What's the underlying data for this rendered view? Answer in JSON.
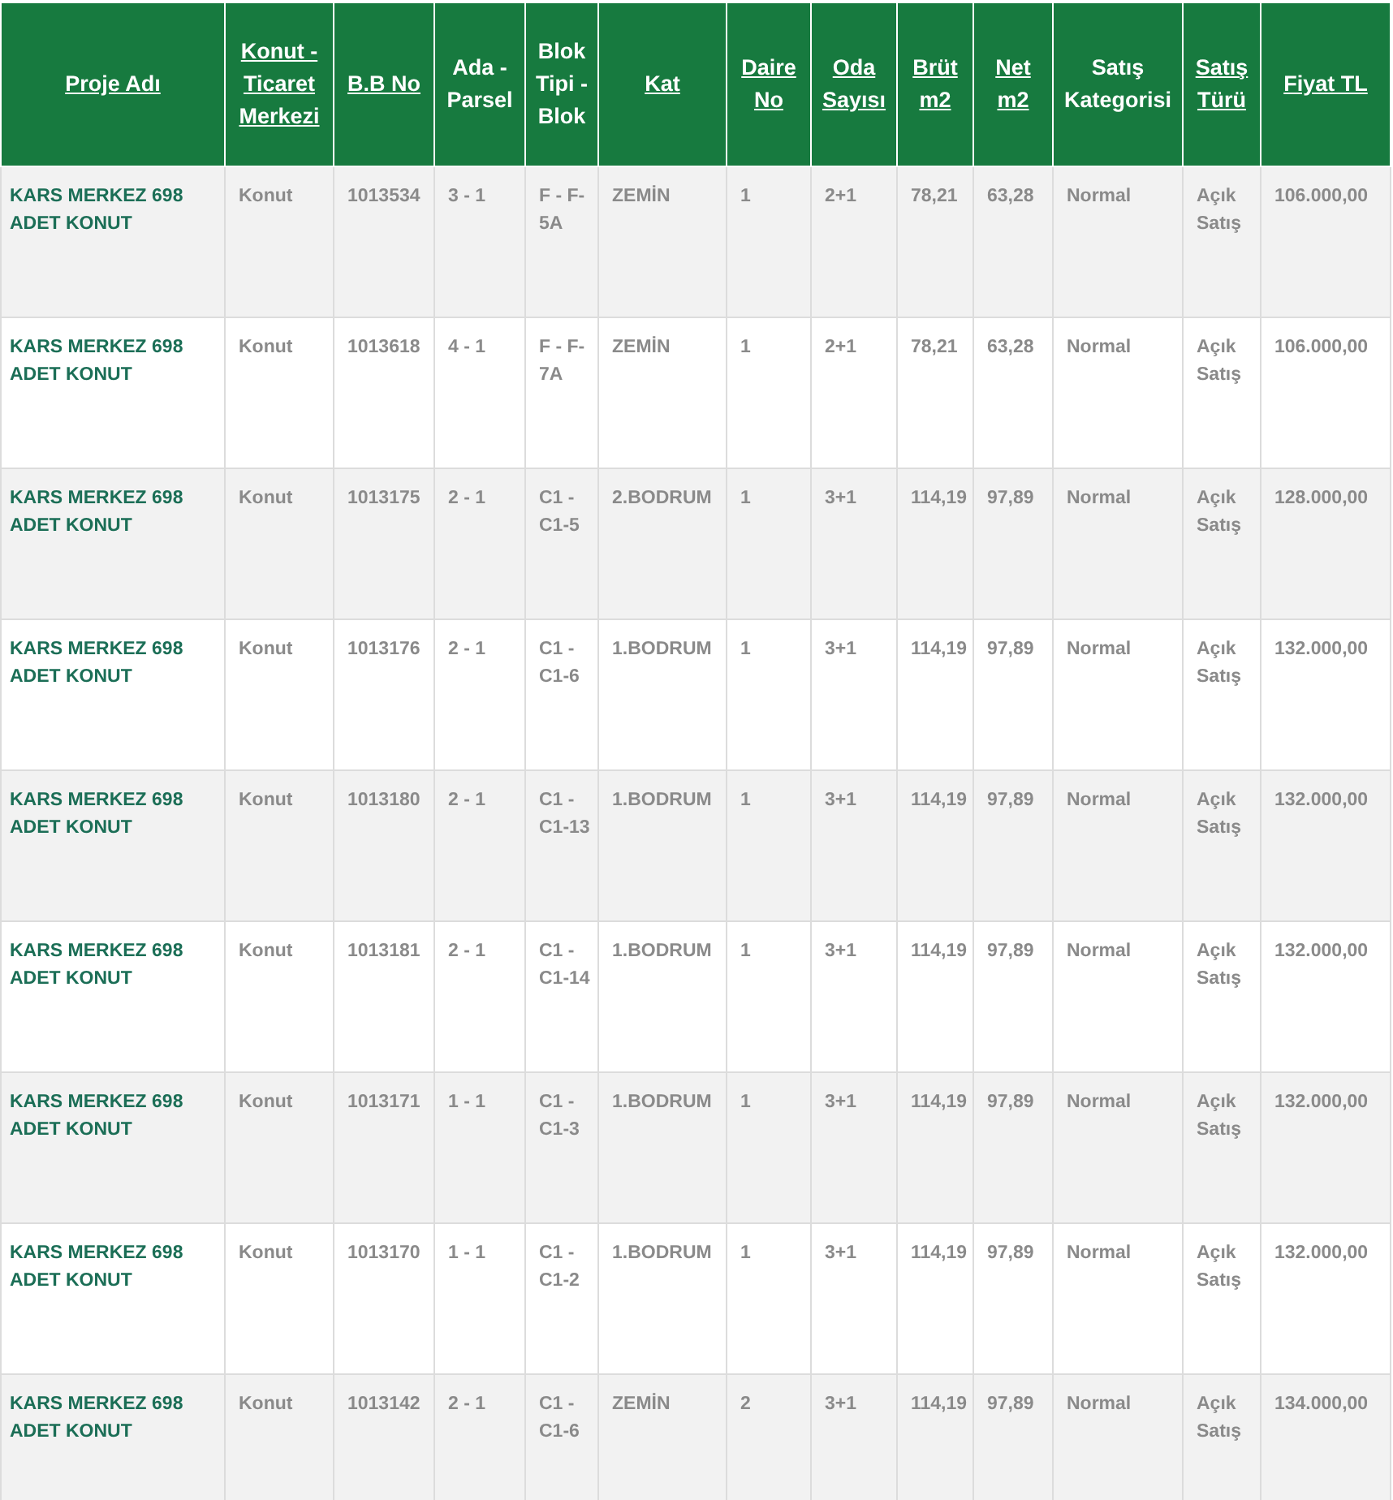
{
  "table": {
    "columns": [
      {
        "label": "Proje Adı",
        "sortable": true
      },
      {
        "label": "Konut - Ticaret Merkezi",
        "sortable": true
      },
      {
        "label": "B.B No",
        "sortable": true
      },
      {
        "label": "Ada - Parsel",
        "sortable": false
      },
      {
        "label": "Blok Tipi - Blok",
        "sortable": false
      },
      {
        "label": "Kat",
        "sortable": true
      },
      {
        "label": "Daire No",
        "sortable": true
      },
      {
        "label": "Oda Sayısı",
        "sortable": true
      },
      {
        "label": "Brüt m2",
        "sortable": true
      },
      {
        "label": "Net m2",
        "sortable": true
      },
      {
        "label": "Satış Kategorisi",
        "sortable": false
      },
      {
        "label": "Satış Türü",
        "sortable": true
      },
      {
        "label": "Fiyat TL",
        "sortable": true
      }
    ],
    "rows": [
      [
        "KARS MERKEZ 698 ADET KONUT",
        "Konut",
        "1013534",
        "3 - 1",
        "F - F-5A",
        "ZEMİN",
        "1",
        "2+1",
        "78,21",
        "63,28",
        "Normal",
        "Açık Satış",
        "106.000,00"
      ],
      [
        "KARS MERKEZ 698 ADET KONUT",
        "Konut",
        "1013618",
        "4 - 1",
        "F - F-7A",
        "ZEMİN",
        "1",
        "2+1",
        "78,21",
        "63,28",
        "Normal",
        "Açık Satış",
        "106.000,00"
      ],
      [
        "KARS MERKEZ 698 ADET KONUT",
        "Konut",
        "1013175",
        "2 - 1",
        "C1 - C1-5",
        "2.BODRUM",
        "1",
        "3+1",
        "114,19",
        "97,89",
        "Normal",
        "Açık Satış",
        "128.000,00"
      ],
      [
        "KARS MERKEZ 698 ADET KONUT",
        "Konut",
        "1013176",
        "2 - 1",
        "C1 - C1-6",
        "1.BODRUM",
        "1",
        "3+1",
        "114,19",
        "97,89",
        "Normal",
        "Açık Satış",
        "132.000,00"
      ],
      [
        "KARS MERKEZ 698 ADET KONUT",
        "Konut",
        "1013180",
        "2 - 1",
        "C1 - C1-13",
        "1.BODRUM",
        "1",
        "3+1",
        "114,19",
        "97,89",
        "Normal",
        "Açık Satış",
        "132.000,00"
      ],
      [
        "KARS MERKEZ 698 ADET KONUT",
        "Konut",
        "1013181",
        "2 - 1",
        "C1 - C1-14",
        "1.BODRUM",
        "1",
        "3+1",
        "114,19",
        "97,89",
        "Normal",
        "Açık Satış",
        "132.000,00"
      ],
      [
        "KARS MERKEZ 698 ADET KONUT",
        "Konut",
        "1013171",
        "1 - 1",
        "C1 - C1-3",
        "1.BODRUM",
        "1",
        "3+1",
        "114,19",
        "97,89",
        "Normal",
        "Açık Satış",
        "132.000,00"
      ],
      [
        "KARS MERKEZ 698 ADET KONUT",
        "Konut",
        "1013170",
        "1 - 1",
        "C1 - C1-2",
        "1.BODRUM",
        "1",
        "3+1",
        "114,19",
        "97,89",
        "Normal",
        "Açık Satış",
        "132.000,00"
      ],
      [
        "KARS MERKEZ 698 ADET KONUT",
        "Konut",
        "1013142",
        "2 - 1",
        "C1 - C1-6",
        "ZEMİN",
        "2",
        "3+1",
        "114,19",
        "97,89",
        "Normal",
        "Açık Satış",
        "134.000,00"
      ]
    ]
  }
}
